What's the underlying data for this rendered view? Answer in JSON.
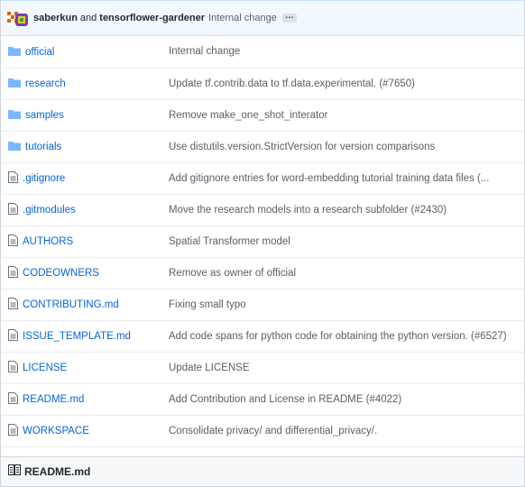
{
  "commit": {
    "author1": "saberkun",
    "and": "and",
    "author2": "tensorflower-gardener",
    "message": "Internal change",
    "ellipsis": "…"
  },
  "files": [
    {
      "name": "official",
      "type": "folder",
      "message": "Internal change"
    },
    {
      "name": "research",
      "type": "folder",
      "message": "Update tf.contrib.data to tf.data.experimental. (#7650)"
    },
    {
      "name": "samples",
      "type": "folder",
      "message": "Remove make_one_shot_interator"
    },
    {
      "name": "tutorials",
      "type": "folder",
      "message": "Use distutils.version.StrictVersion for version comparisons"
    },
    {
      "name": ".gitignore",
      "type": "file",
      "message": "Add gitignore entries for word-embedding tutorial training data files (..."
    },
    {
      "name": ".gitmodules",
      "type": "file",
      "message": "Move the research models into a research subfolder (#2430)"
    },
    {
      "name": "AUTHORS",
      "type": "file",
      "message": "Spatial Transformer model"
    },
    {
      "name": "CODEOWNERS",
      "type": "file",
      "message": "Remove as owner of official"
    },
    {
      "name": "CONTRIBUTING.md",
      "type": "file",
      "message": "Fixing small typo"
    },
    {
      "name": "ISSUE_TEMPLATE.md",
      "type": "file",
      "message": "Add code spans for python code for obtaining the python version. (#6527)"
    },
    {
      "name": "LICENSE",
      "type": "file",
      "message": "Update LICENSE"
    },
    {
      "name": "README.md",
      "type": "file",
      "message": "Add Contribution and License in README (#4022)"
    },
    {
      "name": "WORKSPACE",
      "type": "file",
      "message": "Consolidate privacy/ and differential_privacy/."
    }
  ],
  "readme": {
    "title": "README.md"
  },
  "colors": {
    "folder": "#79b8ff",
    "file": "#6a737d",
    "link": "#0366d6"
  }
}
